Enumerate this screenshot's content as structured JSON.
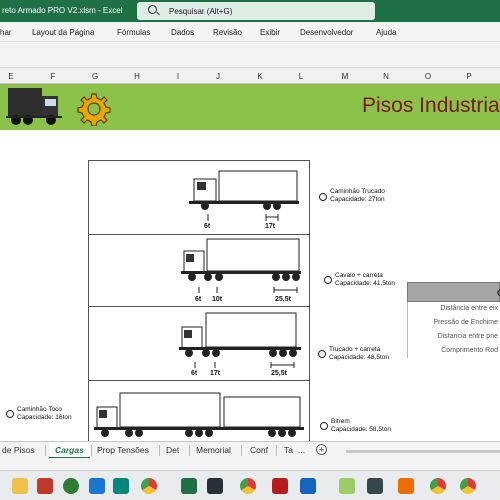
{
  "window": {
    "document_title": "reto Armado PRO V2.xlsm  -  Excel",
    "search_placeholder": "Pesquisar (Alt+G)"
  },
  "ribbon": {
    "tabs": [
      "har",
      "Layout da Página",
      "Fórmulas",
      "Dados",
      "Revisão",
      "Exibir",
      "Desenvolvedor",
      "Ajuda"
    ]
  },
  "columns": [
    "E",
    "F",
    "G",
    "H",
    "I",
    "J",
    "K",
    "L",
    "M",
    "N",
    "O",
    "P"
  ],
  "banner": {
    "title": "Pisos Industria",
    "color": "#8bc34a",
    "icons": [
      "truck-icon",
      "gear-icon"
    ]
  },
  "trucks": [
    {
      "name": "Caminhão Trucado",
      "capacity": "Capacidade: 27ton",
      "axle_loads": [
        "6t",
        "17t"
      ]
    },
    {
      "name": "Cavalo + carreta",
      "capacity": "Capacidade: 41,5ton",
      "axle_loads": [
        "6t",
        "10t",
        "25,5t"
      ]
    },
    {
      "name": "Trucado + carreta",
      "capacity": "Capacidade: 48,5ton",
      "axle_loads": [
        "6t",
        "17t",
        "25,5t"
      ]
    },
    {
      "name": "Bitrem",
      "capacity": "Capacidade: 58,5ton",
      "axle_loads": []
    }
  ],
  "toco": {
    "name": "Caminhão Toco",
    "capacity": "Capacidade: 16ton"
  },
  "side_table": {
    "header": "C",
    "rows": [
      "Distância entre eix",
      "Pressão de Enchime",
      "Distancia entre pne",
      "Comprimento Rod"
    ]
  },
  "sheet_tabs": {
    "items": [
      "de Pisos",
      "Cargas",
      "Prop Tensões",
      "Det",
      "Memorial",
      "Conf",
      "Ta"
    ],
    "active": "Cargas",
    "more": "...",
    "add": "+"
  },
  "taskbar": {
    "apps": [
      "explorer-icon",
      "maps-icon",
      "app-icon",
      "chrome-icon",
      "excel-icon",
      "app-icon",
      "chrome-icon",
      "app-icon",
      "r-icon",
      "word-icon",
      "app-icon",
      "app-icon",
      "chrome-icon",
      "chrome-icon",
      "app-icon"
    ]
  }
}
